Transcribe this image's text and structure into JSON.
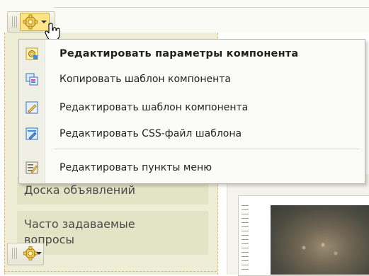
{
  "menu": {
    "items": [
      {
        "label": "Редактировать параметры компонента",
        "icon": "component-settings-icon",
        "bold": true
      },
      {
        "label": "Копировать шаблон компонента",
        "icon": "copy-template-icon"
      },
      {
        "label": "Редактировать шаблон компонента",
        "icon": "edit-template-icon"
      },
      {
        "label": "Редактировать CSS-файл шаблона",
        "icon": "edit-css-icon"
      },
      {
        "label": "Редактировать пункты меню",
        "icon": "edit-menu-items-icon"
      }
    ]
  },
  "sidebar": {
    "items": [
      {
        "label": "Доска объявлений"
      },
      {
        "label": "Часто задаваемые вопросы"
      }
    ]
  },
  "colors": {
    "accent": "#ffe48a",
    "sidebar_bg": "#eeeed6",
    "dash_border": "#f1b15f"
  }
}
